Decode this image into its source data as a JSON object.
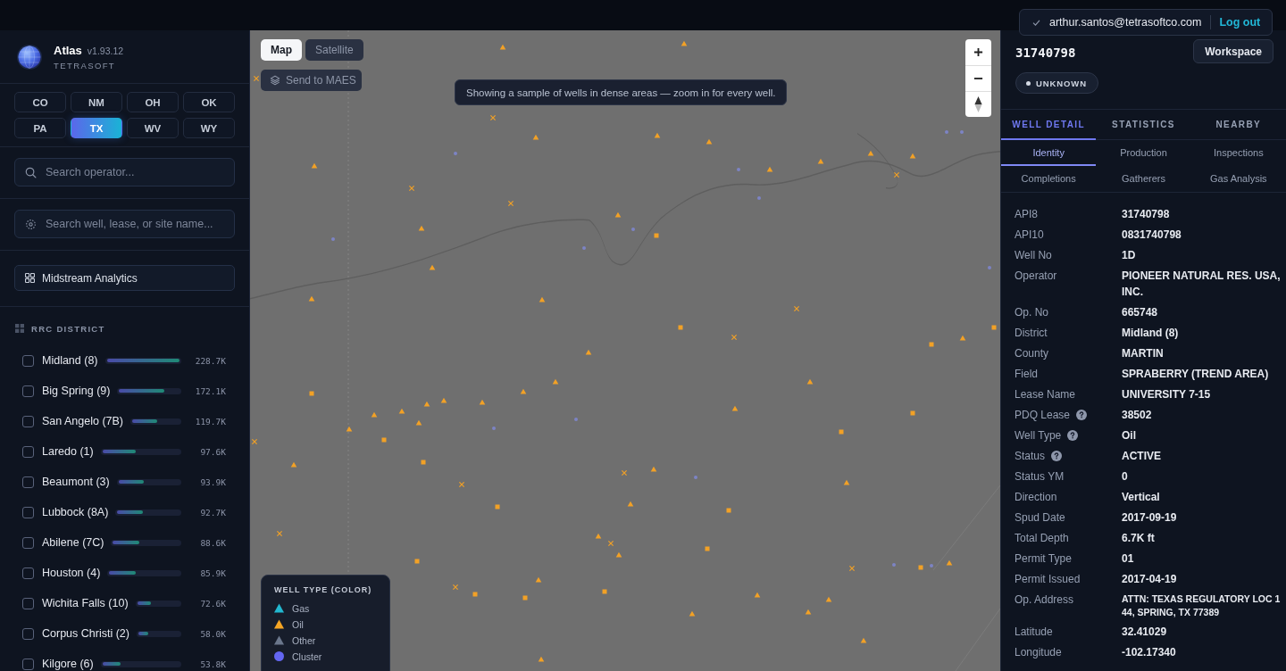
{
  "top_bar": {
    "account": {
      "email": "arthur.santos@tetrasoftco.com",
      "logout": "Log out"
    }
  },
  "sidebar": {
    "app_name": "Atlas",
    "version": "v1.93.12",
    "company": "TETRASOFT",
    "states": [
      {
        "label": "CO",
        "selected": false
      },
      {
        "label": "NM",
        "selected": false
      },
      {
        "label": "OH",
        "selected": false
      },
      {
        "label": "OK",
        "selected": false
      },
      {
        "label": "PA",
        "selected": false
      },
      {
        "label": "TX",
        "selected": true
      },
      {
        "label": "WV",
        "selected": false
      },
      {
        "label": "WY",
        "selected": false
      }
    ],
    "operator_search": {
      "placeholder": "Search operator..."
    },
    "site_search": {
      "placeholder": "Search well, lease, or site name..."
    },
    "analytics_button": "Midstream Analytics",
    "district_filter": {
      "title": "RRC DISTRICT",
      "items": [
        {
          "name": "Midland (8)",
          "checked": false,
          "level": 1.0,
          "value": "228.7K"
        },
        {
          "name": "Big Spring (9)",
          "checked": false,
          "level": 0.75,
          "value": "172.1K"
        },
        {
          "name": "San Angelo (7B)",
          "checked": false,
          "level": 0.52,
          "value": "119.7K"
        },
        {
          "name": "Laredo (1)",
          "checked": false,
          "level": 0.43,
          "value": "97.6K"
        },
        {
          "name": "Beaumont (3)",
          "checked": false,
          "level": 0.41,
          "value": "93.9K"
        },
        {
          "name": "Lubbock (8A)",
          "checked": false,
          "level": 0.41,
          "value": "92.7K"
        },
        {
          "name": "Abilene (7C)",
          "checked": false,
          "level": 0.39,
          "value": "88.6K"
        },
        {
          "name": "Houston (4)",
          "checked": false,
          "level": 0.38,
          "value": "85.9K"
        },
        {
          "name": "Wichita Falls (10)",
          "checked": false,
          "level": 0.32,
          "value": "72.6K"
        },
        {
          "name": "Corpus Christi (2)",
          "checked": false,
          "level": 0.25,
          "value": "58.0K"
        },
        {
          "name": "Kilgore (6)",
          "checked": false,
          "level": 0.24,
          "value": "53.8K"
        }
      ]
    }
  },
  "map": {
    "view_modes": [
      {
        "label": "Map",
        "selected": true
      },
      {
        "label": "Satellite",
        "selected": false
      }
    ],
    "send_button": "Send to MAES",
    "notice": "Showing a sample of wells in dense areas — zoom in for every well.",
    "legend": {
      "title": "WELL TYPE (COLOR)",
      "items": [
        {
          "label": "Gas",
          "kind": "triangle",
          "color": "#22b8d0"
        },
        {
          "label": "Oil",
          "kind": "triangle",
          "color": "#f5a524"
        },
        {
          "label": "Other",
          "kind": "triangle",
          "color": "#6b778c"
        },
        {
          "label": "Cluster",
          "kind": "circle",
          "color": "#6366f1"
        }
      ]
    }
  },
  "detail": {
    "title": "31740798",
    "workspace_button": "Workspace",
    "status": "UNKNOWN",
    "tabs": [
      {
        "label": "WELL DETAIL",
        "selected": true
      },
      {
        "label": "STATISTICS",
        "selected": false
      },
      {
        "label": "NEARBY",
        "selected": false
      }
    ],
    "subtabs": [
      {
        "label": "Identity",
        "selected": true
      },
      {
        "label": "Production",
        "selected": false
      },
      {
        "label": "Inspections",
        "selected": false
      },
      {
        "label": "Completions",
        "selected": false
      },
      {
        "label": "Gatherers",
        "selected": false
      },
      {
        "label": "Gas Analysis",
        "selected": false
      }
    ],
    "fields": [
      {
        "label": "API8",
        "value": "31740798",
        "help": false,
        "kind": "plain"
      },
      {
        "label": "API10",
        "value": "0831740798",
        "help": false,
        "kind": "plain"
      },
      {
        "label": "Well No",
        "value": "1D",
        "help": false,
        "kind": "plain"
      },
      {
        "label": "Operator",
        "value": "PIONEER NATURAL RES. USA, INC.",
        "help": false,
        "kind": "plain"
      },
      {
        "label": "Op. No",
        "value": "665748",
        "help": false,
        "kind": "plain"
      },
      {
        "label": "District",
        "value": "Midland (8)",
        "help": false,
        "kind": "plain"
      },
      {
        "label": "County",
        "value": "MARTIN",
        "help": false,
        "kind": "plain"
      },
      {
        "label": "Field",
        "value": "SPRABERRY (TREND AREA)",
        "help": false,
        "kind": "plain"
      },
      {
        "label": "Lease Name",
        "value": "UNIVERSITY 7-15",
        "help": false,
        "kind": "plain"
      },
      {
        "label": "PDQ Lease",
        "value": "38502",
        "help": true,
        "kind": "plain"
      },
      {
        "label": "Well Type",
        "value": "Oil",
        "help": true,
        "kind": "plain"
      },
      {
        "label": "Status",
        "value": "ACTIVE",
        "help": true,
        "kind": "plain"
      },
      {
        "label": "Status YM",
        "value": "0",
        "help": false,
        "kind": "plain"
      },
      {
        "label": "Direction",
        "value": "Vertical",
        "help": false,
        "kind": "plain"
      },
      {
        "label": "Spud Date",
        "value": "2017-09-19",
        "help": false,
        "kind": "plain"
      },
      {
        "label": "Total Depth",
        "value": "6.7K ft",
        "help": false,
        "kind": "plain"
      },
      {
        "label": "Permit Type",
        "value": "01",
        "help": false,
        "kind": "plain"
      },
      {
        "label": "Permit Issued",
        "value": "2017-04-19",
        "help": false,
        "kind": "plain"
      },
      {
        "label": "Op. Address",
        "value": "ATTN: TEXAS REGULATORY LOC 144, SPRING, TX 77389",
        "help": false,
        "kind": "compact"
      },
      {
        "label": "Latitude",
        "value": "32.41029",
        "help": false,
        "kind": "plain"
      },
      {
        "label": "Longitude",
        "value": "-102.17340",
        "help": false,
        "kind": "plain"
      }
    ]
  }
}
